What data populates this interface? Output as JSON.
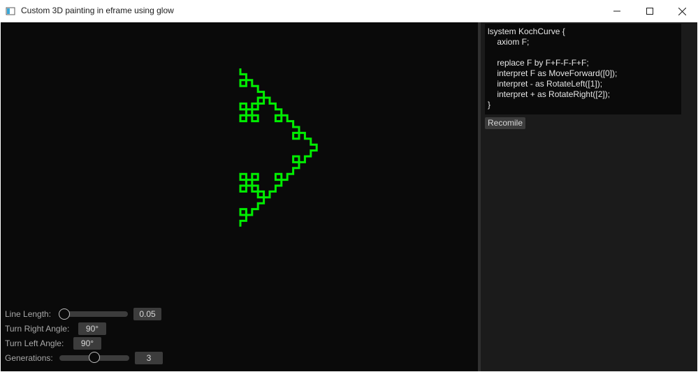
{
  "window": {
    "title": "Custom 3D painting in eframe using glow",
    "icons": [
      "app-icon",
      "minimize-icon",
      "maximize-icon",
      "close-icon"
    ]
  },
  "colors": {
    "fractal": "#00ee00",
    "canvas_bg": "#0a0a0a",
    "panel_bg": "#1b1b1b",
    "widget_bg": "#3c3c3c"
  },
  "editor": {
    "lines": [
      "lsystem KochCurve {",
      "    axiom F;",
      "",
      "    replace F by F+F-F-F+F;",
      "    interpret F as MoveForward([0]);",
      "    interpret - as RotateLeft([1]);",
      "    interpret + as RotateRight([2]);",
      "}"
    ],
    "recompile_label": "Recomile"
  },
  "controls": {
    "line_length": {
      "label": "Line Length:",
      "value": "0.05",
      "slider_fraction": 0.0
    },
    "turn_right": {
      "label": "Turn Right Angle:",
      "value": "90°"
    },
    "turn_left": {
      "label": "Turn Left Angle:",
      "value": "90°"
    },
    "generations": {
      "label": "Generations:",
      "value": "3",
      "slider_fraction": 0.5
    }
  }
}
